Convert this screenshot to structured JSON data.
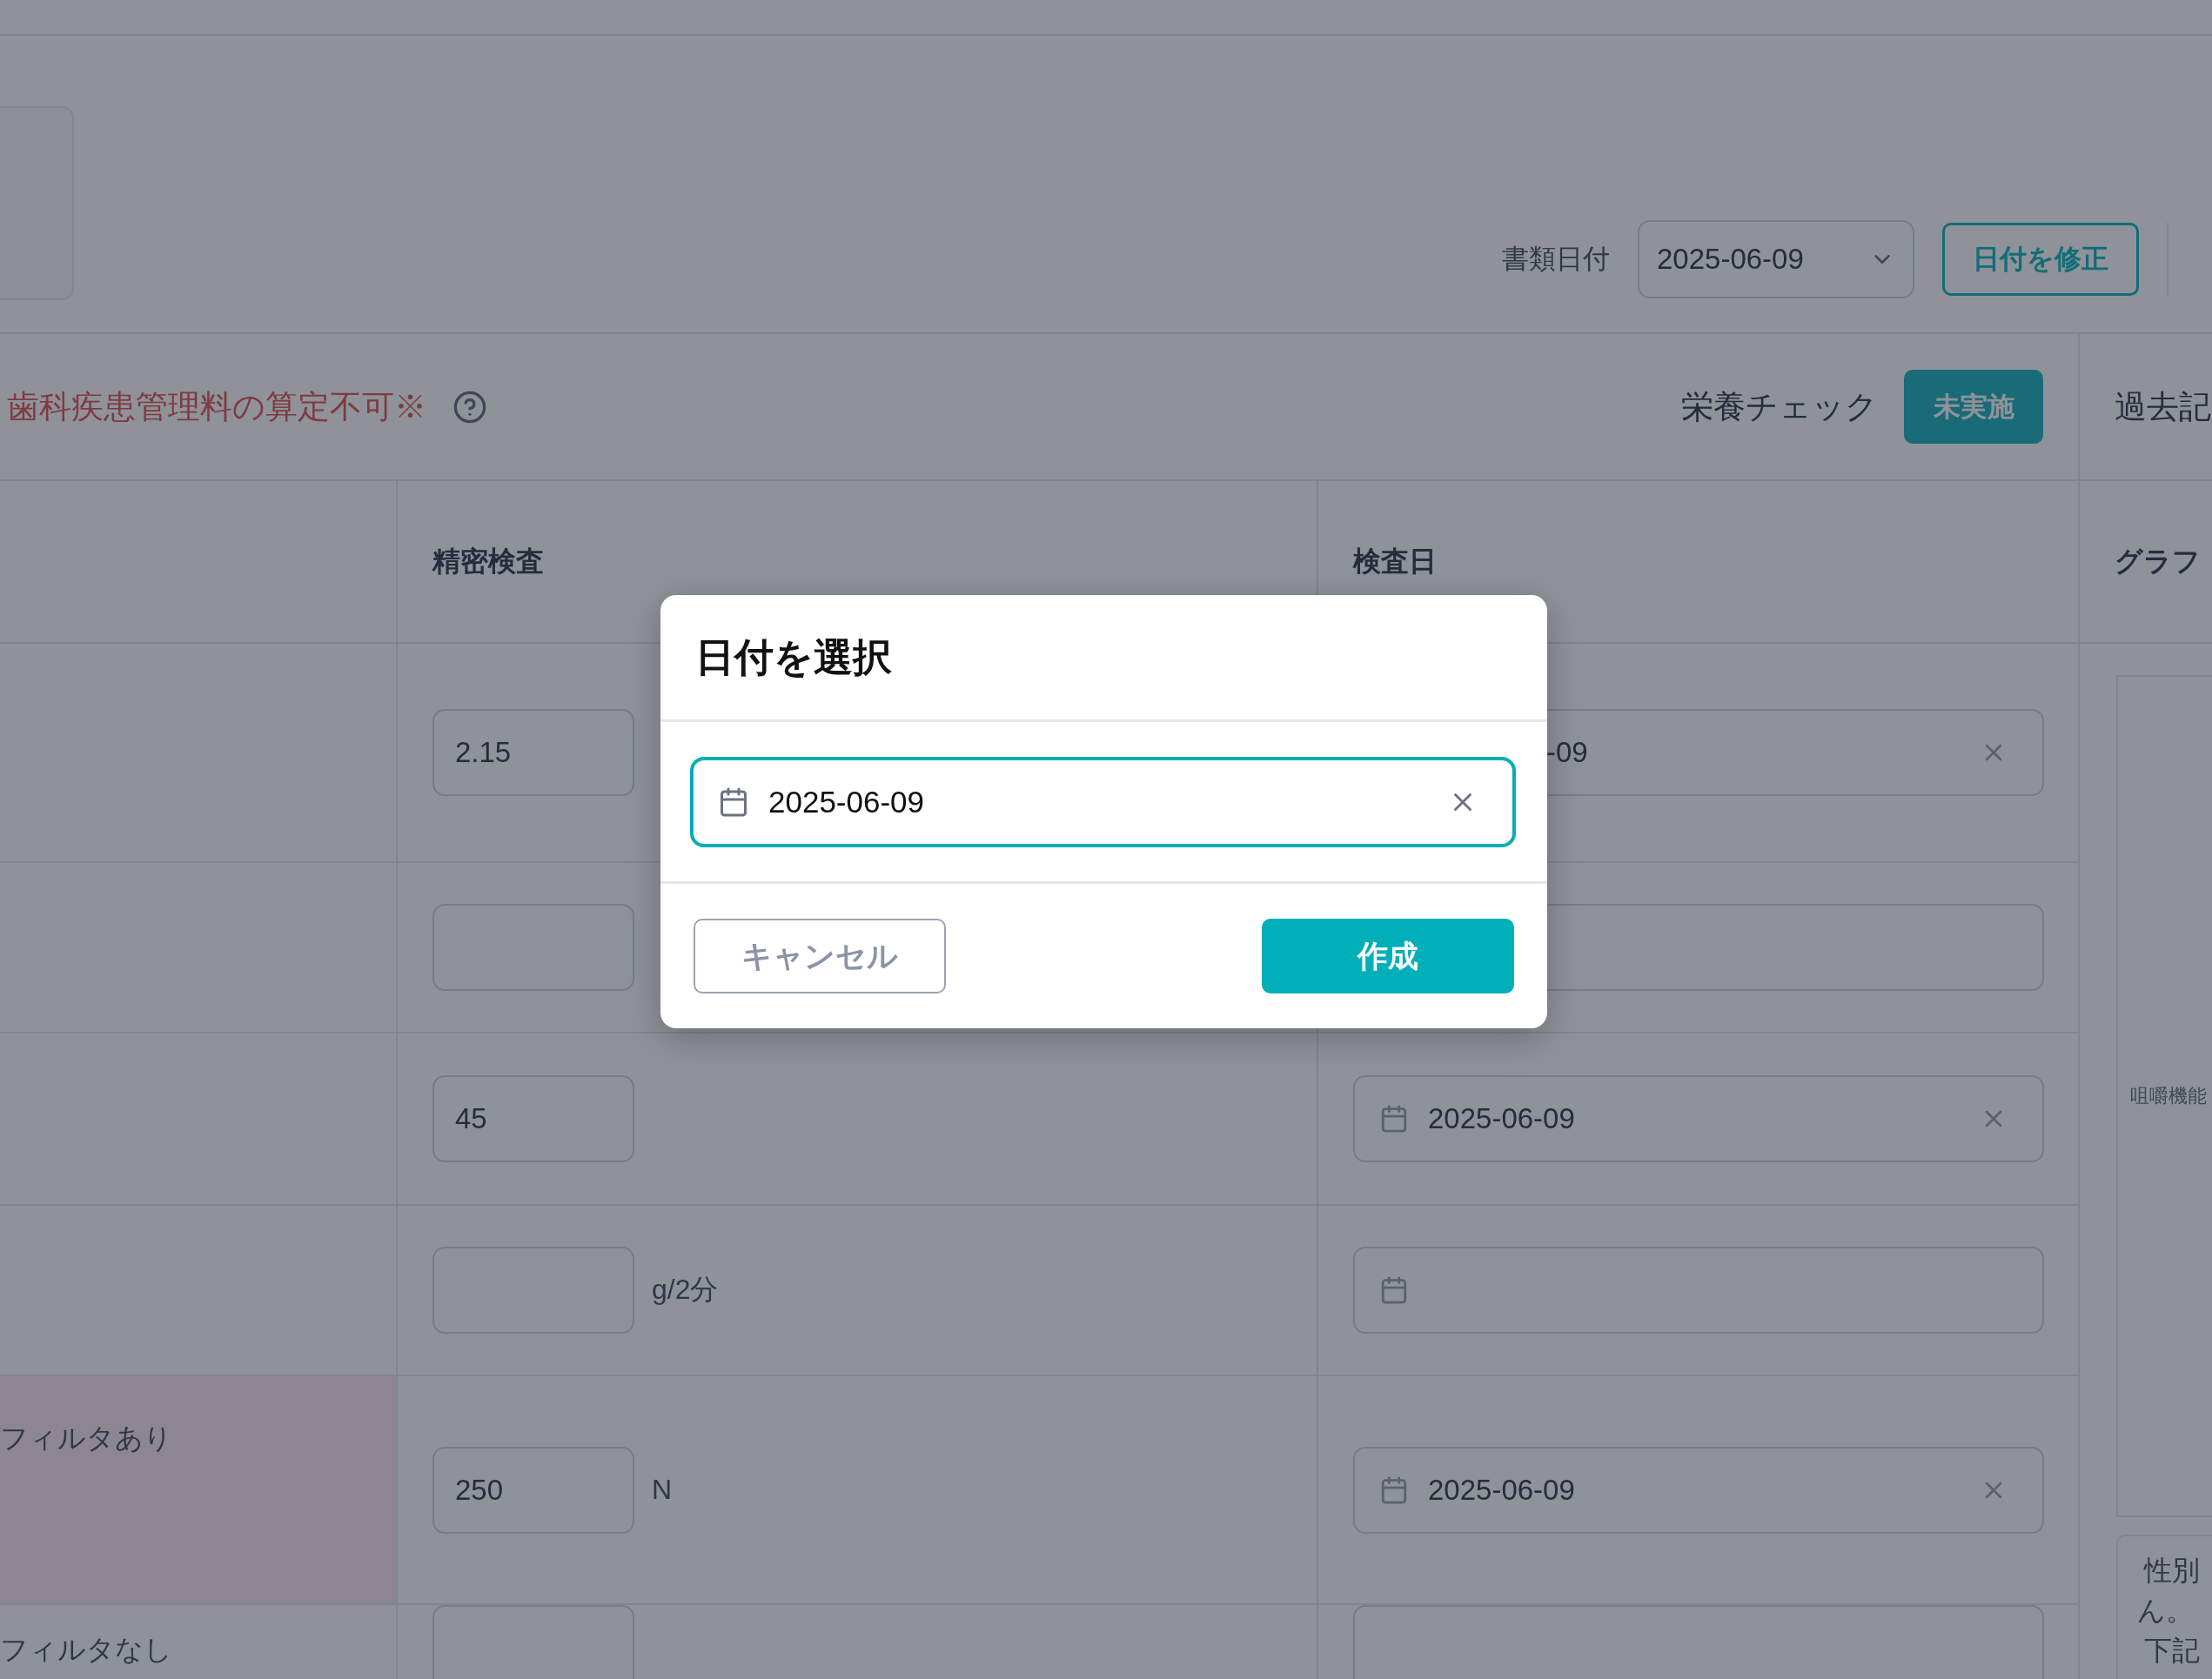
{
  "header": {
    "doc_date_label": "書類日付",
    "doc_date": "2025-06-09",
    "fix_date_button": "日付を修正"
  },
  "status_bar": {
    "warning": "歯科疾患管理料の算定不可※",
    "nutrition_label": "栄養チェック",
    "nutrition_status": "未実施",
    "history_tab": "過去記"
  },
  "table": {
    "columns": [
      {
        "label": "精密検査"
      },
      {
        "label": "検査日"
      }
    ],
    "rows": [
      {
        "highlighted": false,
        "value": "2.15",
        "date": {
          "value": "-09",
          "covered": true
        }
      },
      {
        "highlighted": false,
        "date": {}
      },
      {
        "highlighted": false,
        "value": "45",
        "date": {
          "value": "2025-06-09",
          "covered": false
        }
      },
      {
        "highlighted": false,
        "unit": "g/2分",
        "date": {
          "covered": false
        }
      },
      {
        "label": "フィルタあり",
        "highlighted": true,
        "value": "250",
        "unit": "N",
        "date": {
          "value": "2025-06-09",
          "covered": false
        }
      },
      {
        "label": "フィルタなし",
        "highlighted": false,
        "date": {}
      }
    ]
  },
  "graph_panel": {
    "title": "グラフ",
    "chart_label": "咀嚼機能",
    "note_lines": [
      "性別",
      "ん。",
      "下記"
    ]
  },
  "dialog": {
    "title": "日付を選択",
    "date_value": "2025-06-09",
    "cancel_button": "キャンセル",
    "create_button": "作成"
  }
}
